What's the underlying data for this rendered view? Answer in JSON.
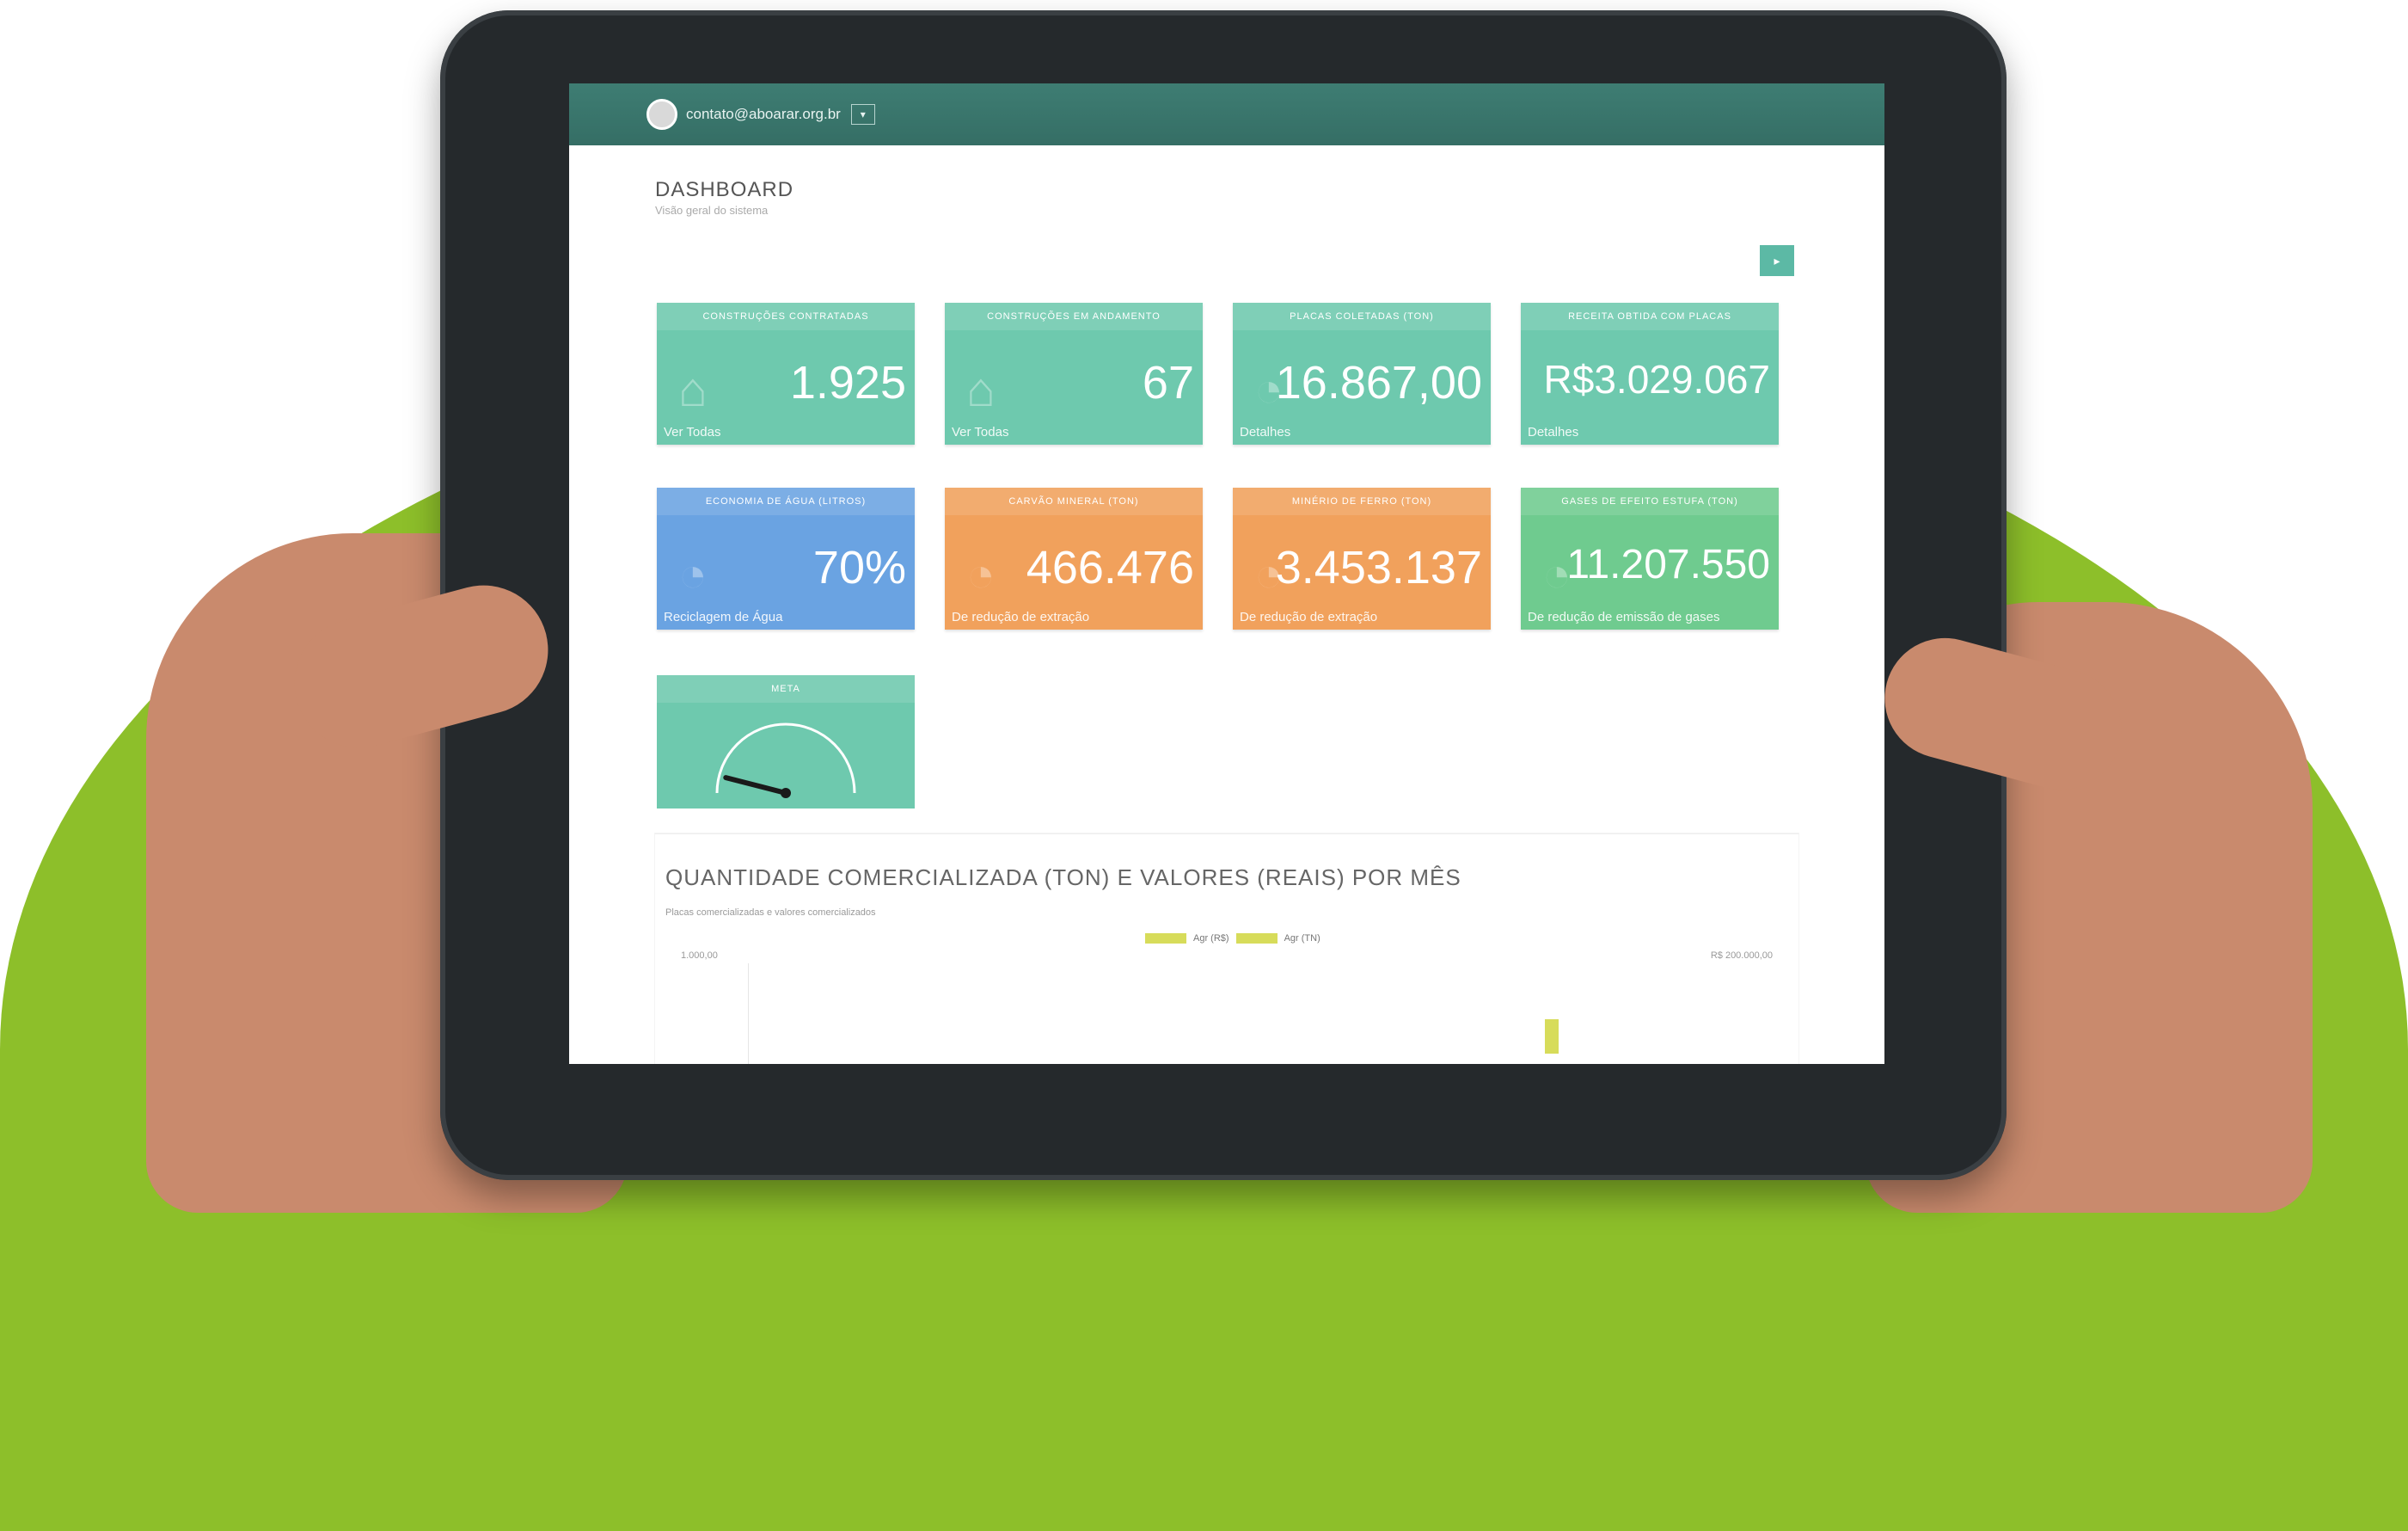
{
  "header": {
    "user_email": "contato@aboarar.org.br",
    "caret": "▾"
  },
  "page": {
    "title": "DASHBOARD",
    "subtitle": "Visão geral do sistema",
    "corner_button": "▸"
  },
  "cards": [
    {
      "title": "CONSTRUÇÕES CONTRATADAS",
      "value": "1.925",
      "footer": "Ver Todas",
      "color": "#6ec9ae",
      "icon": "house-icon"
    },
    {
      "title": "CONSTRUÇÕES EM ANDAMENTO",
      "value": "67",
      "footer": "Ver Todas",
      "color": "#6ec9ae",
      "icon": "house-icon"
    },
    {
      "title": "PLACAS COLETADAS (TON)",
      "value": "16.867,00",
      "footer": "Detalhes",
      "color": "#6ec9ae",
      "icon": "gauge-icon"
    },
    {
      "title": "RECEITA OBTIDA COM PLACAS",
      "value": "R$3.029.067",
      "footer": "Detalhes",
      "color": "#6ec9ae",
      "icon": "none"
    },
    {
      "title": "ECONOMIA DE ÁGUA (LITROS)",
      "value": "70%",
      "footer": "Reciclagem de Água",
      "color": "#6aa3e2",
      "icon": "gauge-icon"
    },
    {
      "title": "CARVÃO MINERAL (TON)",
      "value": "466.476",
      "footer": "De redução de extração",
      "color": "#f1a15c",
      "icon": "gauge-icon"
    },
    {
      "title": "MINÉRIO DE FERRO (TON)",
      "value": "3.453.137",
      "footer": "De redução de extração",
      "color": "#f1a15c",
      "icon": "gauge-icon"
    },
    {
      "title": "GASES DE EFEITO ESTUFA (TON)",
      "value": "11.207.550",
      "footer": "De redução de emissão de gases",
      "color": "#6fcb8f",
      "icon": "gauge-icon"
    }
  ],
  "meta": {
    "title": "META",
    "level": 0.08
  },
  "chart_panel": {
    "title": "QUANTIDADE COMERCIALIZADA (TON) E VALORES (REAIS) POR MÊS",
    "subtitle": "Placas comercializadas e valores comercializados",
    "legend": [
      "Agr (R$)",
      "Agr (TN)"
    ],
    "left_axis_label": "1.000,00",
    "right_axis_label": "R$ 200.000,00"
  }
}
